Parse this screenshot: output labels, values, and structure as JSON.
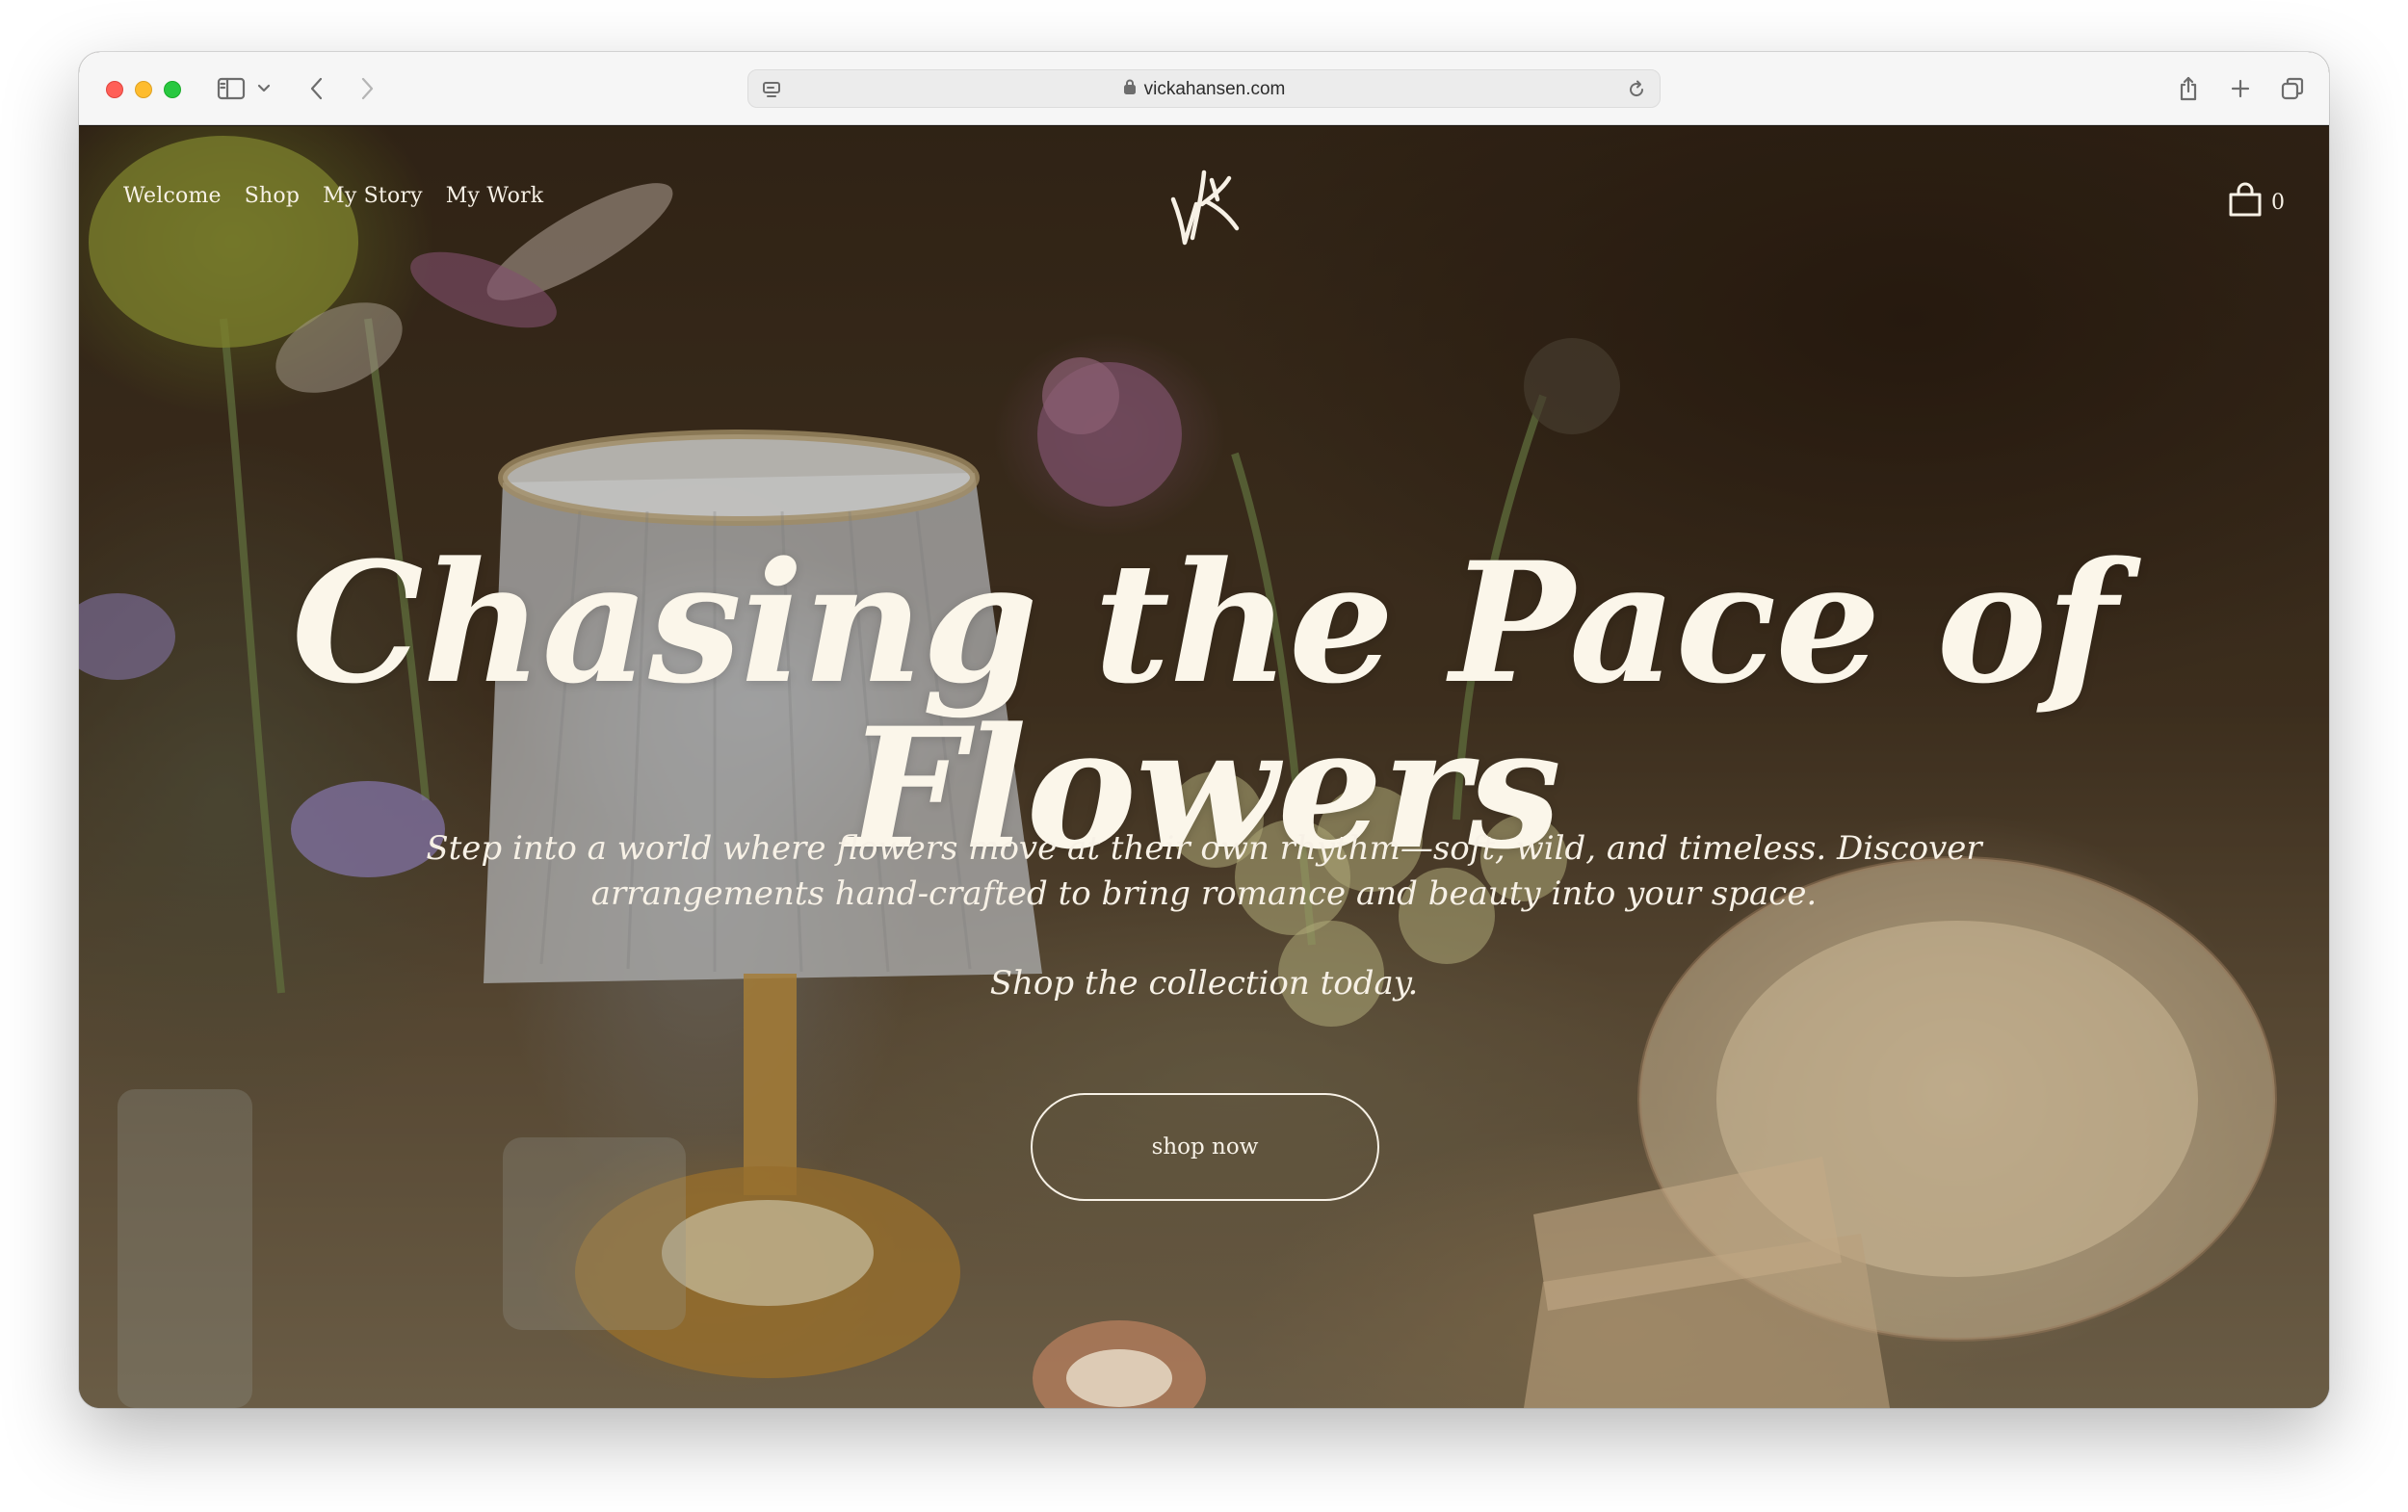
{
  "browser": {
    "url": "vickahansen.com",
    "icons": [
      "sidebar-icon",
      "chevron-down-icon",
      "back-icon",
      "forward-icon",
      "page-menu-icon",
      "lock-icon",
      "reload-icon",
      "share-icon",
      "new-tab-icon",
      "tab-overview-icon"
    ]
  },
  "site": {
    "nav": {
      "welcome": "Welcome",
      "shop": "Shop",
      "my_story": "My Story",
      "my_work": "My Work"
    },
    "logo_text": "VK",
    "cart_count": "0"
  },
  "hero": {
    "headline": "Chasing the Pace of Flowers",
    "subtitle": "Step into a world where flowers move at their own rhythm—soft, wild, and timeless. Discover arrangements hand-crafted to bring romance and beauty into your space.",
    "tagline": "Shop the collection today.",
    "cta_label": "shop now"
  },
  "colors": {
    "text": "#f7f1e6",
    "toolbar_bg": "#f6f6f6",
    "hero_dark": "#2a1f14"
  }
}
